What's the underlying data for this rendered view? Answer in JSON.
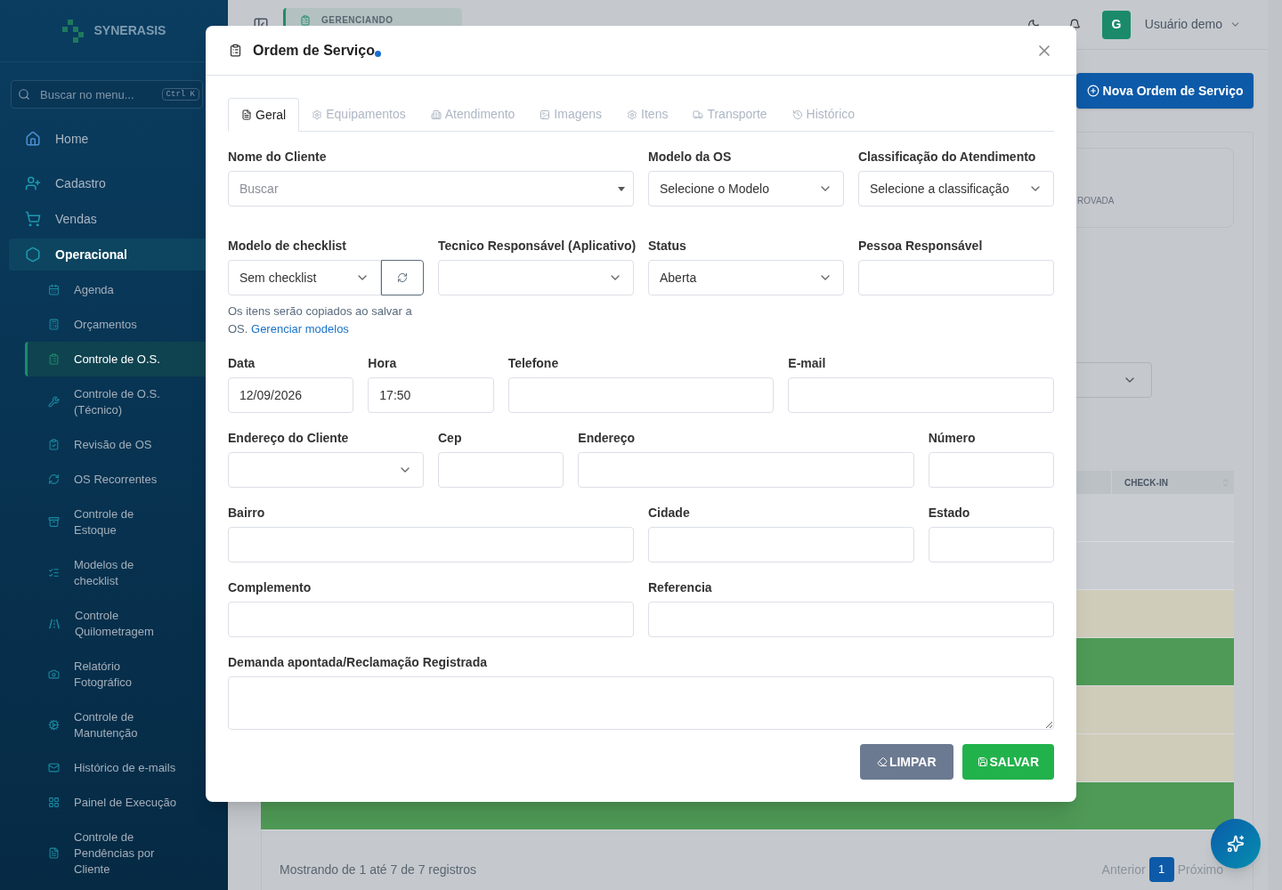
{
  "sidebar": {
    "logo": "SYNERASIS",
    "search": {
      "placeholder": "Buscar no menu...",
      "shortcut": "Ctrl K"
    },
    "items": [
      {
        "label": "Home",
        "kind": "link"
      },
      {
        "label": "Cadastro",
        "kind": "group",
        "expanded": false
      },
      {
        "label": "Vendas",
        "kind": "group",
        "expanded": false
      },
      {
        "label": "Operacional",
        "kind": "group",
        "expanded": true,
        "children": [
          {
            "label": "Agenda",
            "selected": false
          },
          {
            "label": "Orçamentos",
            "selected": false
          },
          {
            "label": "Controle de O.S.",
            "selected": true
          },
          {
            "label": "Controle de O.S. (Técnico)",
            "selected": false
          },
          {
            "label": "Revisão de OS",
            "selected": false
          },
          {
            "label": "OS Recorrentes",
            "selected": false
          },
          {
            "label": "Controle de Estoque",
            "selected": false
          },
          {
            "label": "Modelos de checklist",
            "selected": false
          },
          {
            "label": "Controle Quilometragem",
            "selected": false
          },
          {
            "label": "Relatório Fotográfico",
            "selected": false
          },
          {
            "label": "Controle de Manutenção",
            "selected": false
          },
          {
            "label": "Histórico de e-mails",
            "selected": false
          },
          {
            "label": "Painel de Execução",
            "selected": false
          },
          {
            "label": "Controle de Pendências por Cliente",
            "selected": false
          }
        ]
      }
    ]
  },
  "topbar": {
    "context_badge": "GERENCIANDO",
    "avatar_initial": "G",
    "user_name": "Usuário demo"
  },
  "page": {
    "new_button": "Nova Ordem de Serviço",
    "stat_card": {
      "label": "ROVADA"
    },
    "table": {
      "columns": [
        "CHECK-IN"
      ],
      "rows": [
        {
          "color": "#c9cdd1"
        },
        {
          "color": "#c9cdd1"
        },
        {
          "color": "#d0ccba"
        },
        {
          "color": "#4f9a56"
        },
        {
          "color": "#d0ccba"
        },
        {
          "color": "#d0ccba"
        },
        {
          "color": "#4f9a56"
        }
      ]
    },
    "footer": "Mostrando de 1 até 7 de 7 registros",
    "pagination": {
      "previous": "Anterior",
      "pages": [
        {
          "label": "1",
          "selected": true
        }
      ],
      "next": "Próximo"
    }
  },
  "modal": {
    "title": "Ordem de Serviço",
    "unsaved": true,
    "tabs": [
      {
        "label": "Geral",
        "selected": true
      },
      {
        "label": "Equipamentos",
        "selected": false
      },
      {
        "label": "Atendimento",
        "selected": false
      },
      {
        "label": "Imagens",
        "selected": false
      },
      {
        "label": "Itens",
        "selected": false
      },
      {
        "label": "Transporte",
        "selected": false
      },
      {
        "label": "Histórico",
        "selected": false
      }
    ],
    "field_groups": [
      {
        "fields": [
          {
            "label": "Nome do Cliente",
            "kind": "combo",
            "placeholder": "Buscar"
          },
          {
            "label": "Modelo da OS",
            "kind": "select",
            "value": "Selecione o Modelo"
          },
          {
            "label": "Classificação do Atendimento",
            "kind": "select",
            "value": "Selecione a classificação"
          }
        ]
      },
      {
        "fields": [
          {
            "label": "Modelo de checklist",
            "kind": "select_refresh",
            "value": "Sem checklist",
            "helper": {
              "text": "Os itens serão copiados ao salvar a OS.",
              "link": "Gerenciar modelos"
            }
          },
          {
            "label": "Tecnico Responsável (Aplicativo)",
            "kind": "select"
          },
          {
            "label": "Status",
            "kind": "select",
            "value": "Aberta"
          },
          {
            "label": "Pessoa Responsável",
            "kind": "input"
          }
        ]
      },
      {
        "fields": [
          {
            "label": "Data",
            "kind": "input",
            "value": "12/09/2026"
          },
          {
            "label": "Hora",
            "kind": "input",
            "value": "17:50"
          },
          {
            "label": "Telefone",
            "kind": "input"
          },
          {
            "label": "E-mail",
            "kind": "input"
          }
        ]
      },
      {
        "fields": [
          {
            "label": "Endereço do Cliente",
            "kind": "select"
          },
          {
            "label": "Cep",
            "kind": "input"
          },
          {
            "label": "Endereço",
            "kind": "input"
          },
          {
            "label": "Número",
            "kind": "input"
          }
        ]
      },
      {
        "fields": [
          {
            "label": "Bairro",
            "kind": "input"
          },
          {
            "label": "Cidade",
            "kind": "input"
          },
          {
            "label": "Estado",
            "kind": "input"
          }
        ]
      },
      {
        "fields": [
          {
            "label": "Complemento",
            "kind": "input"
          },
          {
            "label": "Referencia",
            "kind": "input"
          }
        ]
      },
      {
        "fields": [
          {
            "label": "Demanda apontada/Reclamação Registrada",
            "kind": "textarea"
          }
        ]
      }
    ],
    "buttons": [
      {
        "label": "LIMPAR",
        "kind": "clear"
      },
      {
        "label": "SALVAR",
        "kind": "save"
      }
    ]
  }
}
